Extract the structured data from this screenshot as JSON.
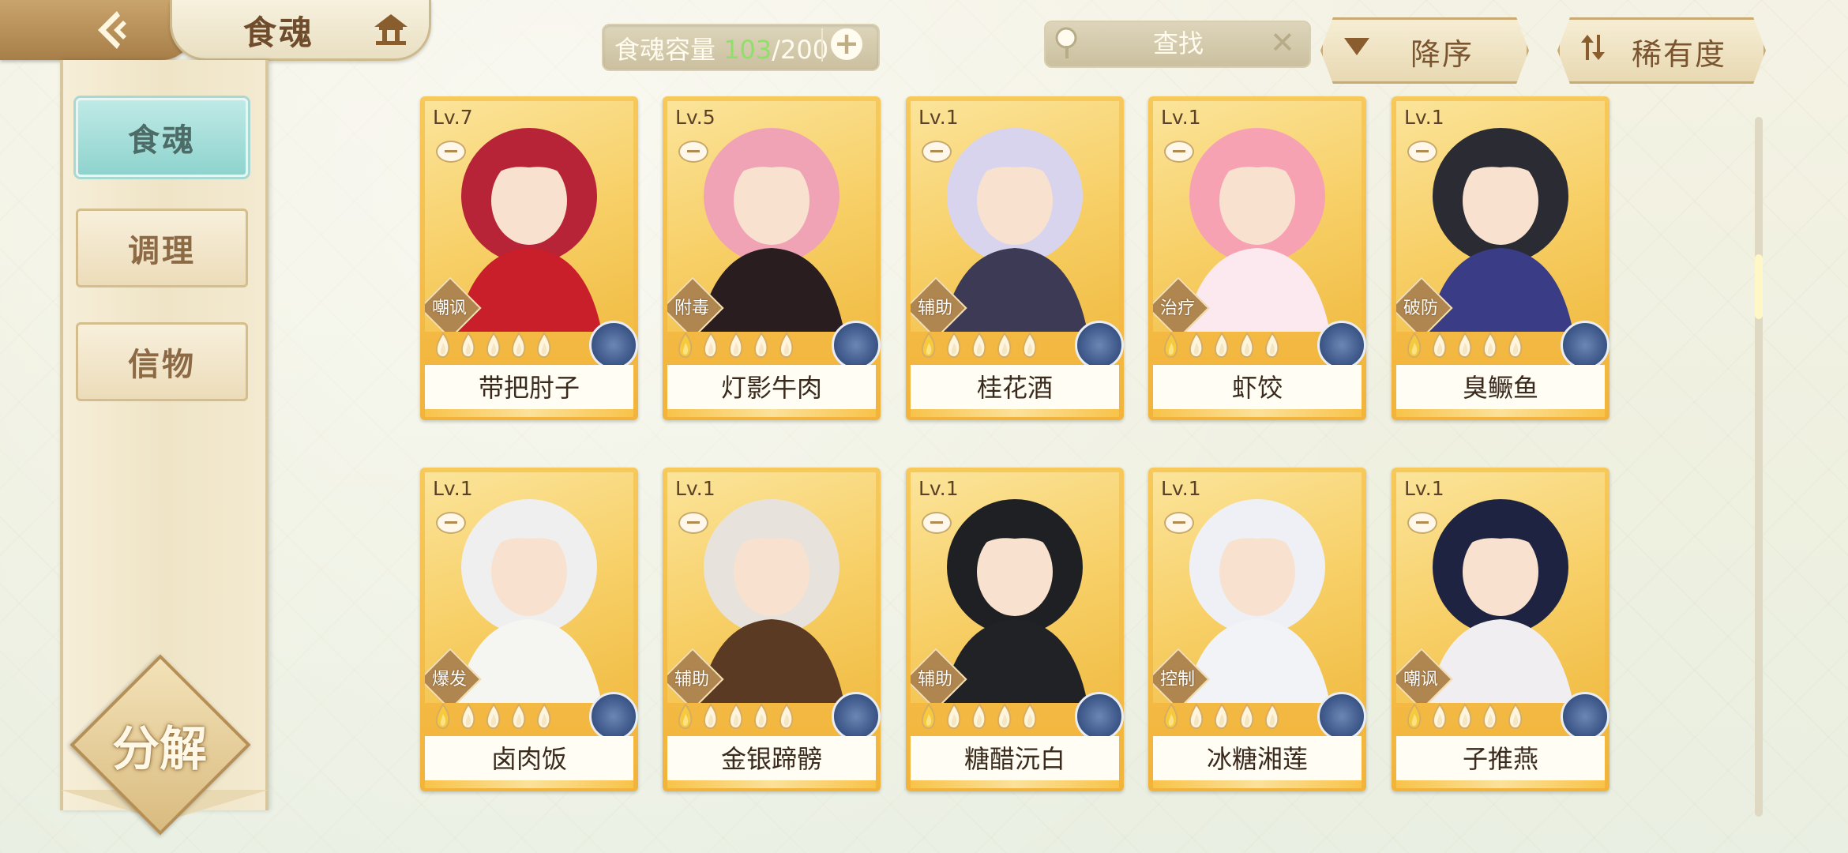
{
  "header": {
    "title": "食魂",
    "capacity_label": "食魂容量",
    "capacity_current": "103",
    "capacity_total": "/200",
    "add_symbol": "+",
    "search_placeholder": "查找",
    "clear_symbol": "✕",
    "sort_order_label": "降序",
    "sort_rarity_label": "稀有度"
  },
  "sidebar": {
    "items": [
      {
        "label": "食魂",
        "active": true
      },
      {
        "label": "调理",
        "active": false
      },
      {
        "label": "信物",
        "active": false
      }
    ],
    "decompose_label": "分解"
  },
  "cards": [
    {
      "level": "Lv.7",
      "role": "嘲讽",
      "name": "带把肘子",
      "stars_filled": 0,
      "hair": "#b82437",
      "outfit": "#c81f2a"
    },
    {
      "level": "Lv.5",
      "role": "附毒",
      "name": "灯影牛肉",
      "stars_filled": 1,
      "hair": "#f0a3b5",
      "outfit": "#2a1d1f"
    },
    {
      "level": "Lv.1",
      "role": "辅助",
      "name": "桂花酒",
      "stars_filled": 1,
      "hair": "#d9d4ee",
      "outfit": "#3c3a55"
    },
    {
      "level": "Lv.1",
      "role": "治疗",
      "name": "虾饺",
      "stars_filled": 1,
      "hair": "#f6a2b3",
      "outfit": "#fbe9ef"
    },
    {
      "level": "Lv.1",
      "role": "破防",
      "name": "臭鳜鱼",
      "stars_filled": 1,
      "hair": "#2b2b33",
      "outfit": "#3a3d86"
    },
    {
      "level": "Lv.1",
      "role": "爆发",
      "name": "卤肉饭",
      "stars_filled": 1,
      "hair": "#efefef",
      "outfit": "#f5f5f2"
    },
    {
      "level": "Lv.1",
      "role": "辅助",
      "name": "金银蹄髈",
      "stars_filled": 1,
      "hair": "#e8e2dc",
      "outfit": "#5a3a22"
    },
    {
      "level": "Lv.1",
      "role": "辅助",
      "name": "糖醋沅白",
      "stars_filled": 1,
      "hair": "#1f2024",
      "outfit": "#202226"
    },
    {
      "level": "Lv.1",
      "role": "控制",
      "name": "冰糖湘莲",
      "stars_filled": 1,
      "hair": "#eef0f5",
      "outfit": "#f2f3f6"
    },
    {
      "level": "Lv.1",
      "role": "嘲讽",
      "name": "子推燕",
      "stars_filled": 1,
      "hair": "#1d2340",
      "outfit": "#f0eef0"
    }
  ],
  "colors": {
    "accent_gold": "#f2b33a",
    "capacity_green": "#8fe06a",
    "active_tab": "#8fd3ce",
    "text_brown": "#7a5530"
  }
}
